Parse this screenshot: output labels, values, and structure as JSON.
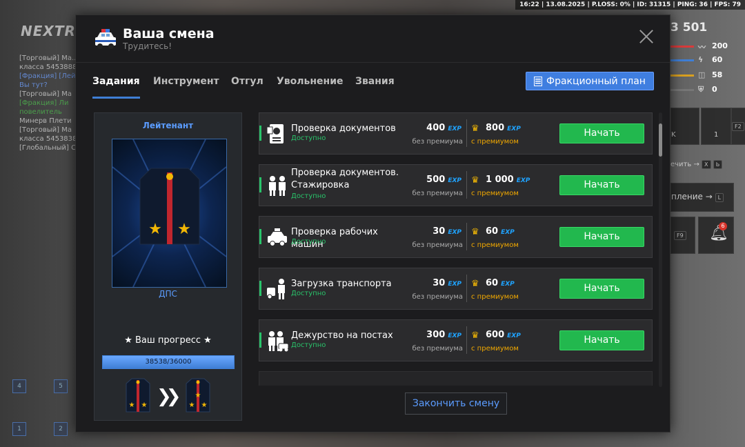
{
  "hud": {
    "status_line": "16:22 | 13.08.2025 | P.LOSS: 0% | ID: 31315 | PING: 36 | FPS: 79"
  },
  "background": {
    "logo": "NEXTRP",
    "chat": [
      {
        "text": "[Торговый] Ма...",
        "color": "#d8d8d8"
      },
      {
        "text": "класса 5453888",
        "color": "#d8d8d8"
      },
      {
        "text": "[Фракция] [Лей",
        "color": "#6fa0ff"
      },
      {
        "text": "Вы тут?",
        "color": "#6fa0ff"
      },
      {
        "text": "[Торговый] Ма",
        "color": "#d8d8d8"
      },
      {
        "text": "[Фракция] Ли",
        "color": "#4fbf4f"
      },
      {
        "text": "повелитель",
        "color": "#4fbf4f"
      },
      {
        "text": "Минерв Плети",
        "color": "#d8d8d8"
      },
      {
        "text": "[Торговый] Ма",
        "color": "#d8d8d8"
      },
      {
        "text": "класса 5453838",
        "color": "#d8d8d8"
      },
      {
        "text": "[Глобальный] С",
        "color": "#d8d8d8"
      }
    ],
    "money": "3 501",
    "stats": [
      {
        "value": "200",
        "color": "#d93a3a"
      },
      {
        "value": "60",
        "color": "#3f7fd6"
      },
      {
        "value": "58",
        "color": "#d9a020"
      },
      {
        "value": "0",
        "color": "#777777"
      }
    ],
    "key_f2": "F2",
    "key_f9": "F9",
    "inv_count": "1",
    "inv_k": "K",
    "text_close": "ечить",
    "text_manage": "пление",
    "key_x": "X",
    "key_b": "Ь",
    "key_l": "L",
    "bell_count": "6",
    "slots": [
      "4",
      "5",
      "1",
      "2"
    ]
  },
  "modal": {
    "title": "Ваша смена",
    "subtitle": "Трудитесь!",
    "tabs": [
      {
        "label": "Задания",
        "active": true
      },
      {
        "label": "Инструмент",
        "active": false
      },
      {
        "label": "Отгул",
        "active": false
      },
      {
        "label": "Увольнение",
        "active": false
      },
      {
        "label": "Звания",
        "active": false
      }
    ],
    "faction_plan_label": "Фракционный план",
    "rank": {
      "title": "Лейтенант",
      "branch": "ДПС",
      "progress_label": "★ Ваш прогресс ★",
      "progress_text": "38538/36000",
      "progress_fraction": 1.0
    },
    "exp_tag": "EXP",
    "base_sub": "без премиума",
    "prem_sub": "с премиумом",
    "start_label": "Начать",
    "tasks": [
      {
        "name": "Проверка документов",
        "status": "Доступно",
        "exp": "400",
        "exp_premium": "800",
        "icon": "passport-icon"
      },
      {
        "name": "Проверка документов. Стажировка",
        "status": "Доступно",
        "exp": "500",
        "exp_premium": "1 000",
        "icon": "officers-icon"
      },
      {
        "name": "Проверка рабочих машин",
        "status": "Доступно",
        "exp": "30",
        "exp_premium": "60",
        "icon": "police-car-icon"
      },
      {
        "name": "Загрузка транспорта",
        "status": "Доступно",
        "exp": "30",
        "exp_premium": "60",
        "icon": "officer-car-icon"
      },
      {
        "name": "Дежурство на постах",
        "status": "Доступно",
        "exp": "300",
        "exp_premium": "600",
        "icon": "post-duty-icon"
      }
    ],
    "end_shift_label": "Закончить смену"
  }
}
